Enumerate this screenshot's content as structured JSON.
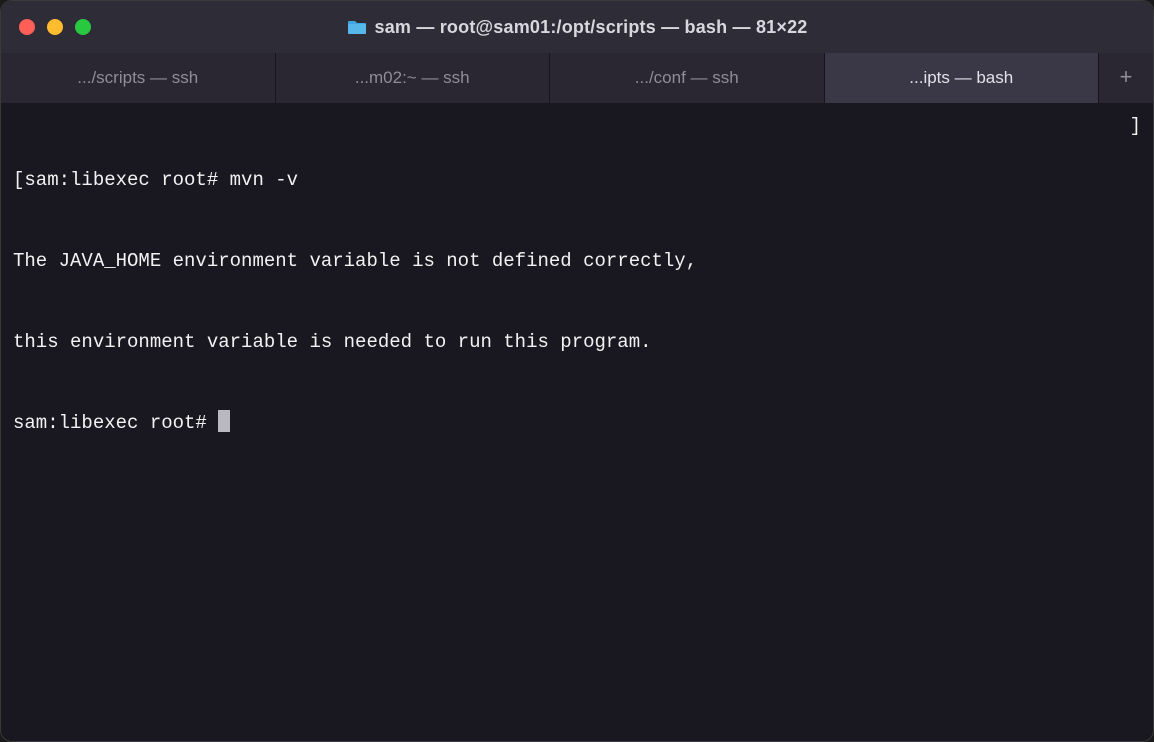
{
  "window": {
    "title": "sam — root@sam01:/opt/scripts — bash — 81×22"
  },
  "tabs": {
    "items": [
      {
        "label": ".../scripts — ssh",
        "active": false
      },
      {
        "label": "...m02:~ — ssh",
        "active": false
      },
      {
        "label": ".../conf — ssh",
        "active": false
      },
      {
        "label": "...ipts — bash",
        "active": true
      }
    ]
  },
  "terminal": {
    "left_bracket": "[",
    "right_bracket": "]",
    "lines": [
      "sam:libexec root# mvn -v",
      "The JAVA_HOME environment variable is not defined correctly,",
      "this environment variable is needed to run this program.",
      "sam:libexec root# "
    ]
  }
}
